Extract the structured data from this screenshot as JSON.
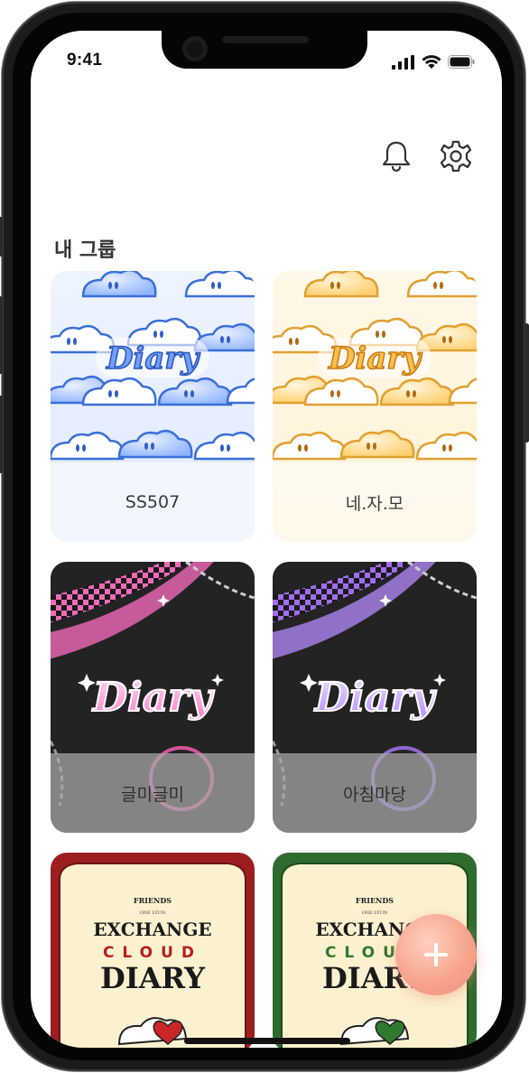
{
  "status_bar": {
    "time": "9:41"
  },
  "header": {
    "notification_icon": "bell-icon",
    "settings_icon": "gear-icon"
  },
  "section": {
    "title": "내 그룹"
  },
  "groups": [
    {
      "name": "SS507",
      "cover": "blue-cloud-diary"
    },
    {
      "name": "네.자.모",
      "cover": "yellow-cloud-diary"
    },
    {
      "name": "글미글미",
      "cover": "pink-checker-diary"
    },
    {
      "name": "아침마당",
      "cover": "purple-checker-diary"
    },
    {
      "name": "",
      "cover": "red-exchange-cloud-diary"
    },
    {
      "name": "",
      "cover": "green-exchange-cloud-diary"
    }
  ],
  "cover_text": {
    "diary": "Diary",
    "friends": "FRIENDS",
    "exchange": "EXCHANGE",
    "cloud": "CLOUD",
    "diary_caps": "DIARY",
    "subline": "ONE LYUN"
  },
  "fab": {
    "label": "+"
  },
  "colors": {
    "accent": "#f4a08b",
    "blue": "#7aa6ff",
    "yellow": "#f6c46a",
    "pink": "#ff8fcf",
    "purple": "#b98cff",
    "red": "#b62a2a",
    "green": "#2e6b2c"
  }
}
